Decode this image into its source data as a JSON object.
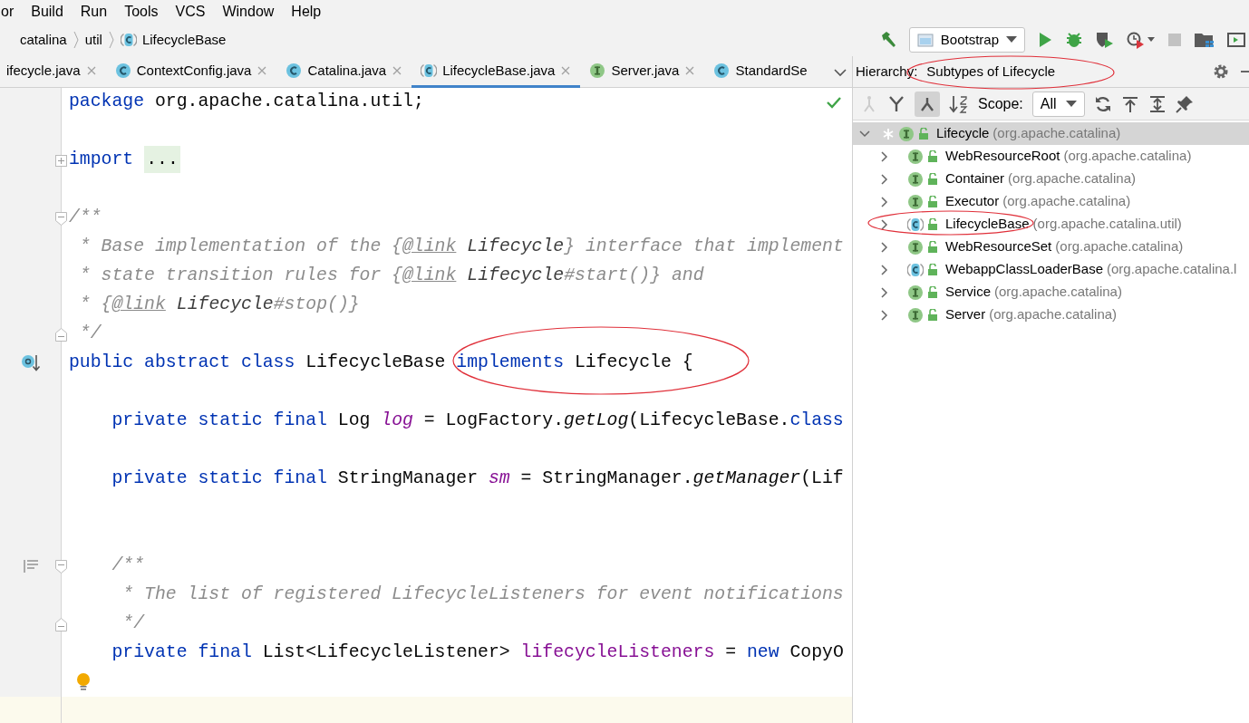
{
  "menu": [
    {
      "label": "or"
    },
    {
      "label": "Build"
    },
    {
      "label": "Run"
    },
    {
      "label": "Tools"
    },
    {
      "label": "VCS"
    },
    {
      "label": "Window"
    },
    {
      "label": "Help"
    }
  ],
  "breadcrumb": [
    {
      "label": "catalina"
    },
    {
      "label": "util"
    },
    {
      "label": "LifecycleBase",
      "kind": "abstract-class"
    }
  ],
  "run_config": {
    "label": "Bootstrap"
  },
  "tabs": [
    {
      "label": "ifecycle.java",
      "selected": false,
      "closable": true
    },
    {
      "label": "ContextConfig.java",
      "kind": "class",
      "selected": false,
      "closable": true
    },
    {
      "label": "Catalina.java",
      "kind": "class",
      "selected": false,
      "closable": true
    },
    {
      "label": "LifecycleBase.java",
      "kind": "abstract-class",
      "selected": true,
      "closable": true
    },
    {
      "label": "Server.java",
      "kind": "interface",
      "selected": false,
      "closable": true
    },
    {
      "label": "StandardSe",
      "kind": "class",
      "selected": false,
      "closable": false
    }
  ],
  "editor": {
    "lines": [
      {
        "current": false,
        "tokens": [
          {
            "kind": "keyword",
            "text": "package"
          },
          {
            "kind": "plain",
            "text": " org.apache.catalina.util;"
          }
        ]
      },
      {
        "current": false
      },
      {
        "current": false,
        "tokens": [
          {
            "kind": "keyword",
            "text": "import"
          },
          {
            "kind": "folded",
            "text": "..."
          }
        ]
      },
      {
        "current": false
      },
      {
        "current": false,
        "tokens": [
          {
            "kind": "comment",
            "text": "/**"
          }
        ]
      },
      {
        "current": false,
        "tokens": [
          {
            "kind": "comment",
            "text": " * Base implementation of the {"
          },
          {
            "kind": "doctag",
            "text": "@link"
          },
          {
            "kind": "docref",
            "text": "Lifecycle"
          },
          {
            "kind": "comment",
            "text": "} interface that implement"
          }
        ]
      },
      {
        "current": false,
        "tokens": [
          {
            "kind": "comment",
            "text": " * state transition rules for {"
          },
          {
            "kind": "doctag",
            "text": "@link"
          },
          {
            "kind": "docref",
            "text": "Lifecycle"
          },
          {
            "kind": "comment",
            "text": "#start()} and"
          }
        ]
      },
      {
        "current": false,
        "tokens": [
          {
            "kind": "comment",
            "text": " * {"
          },
          {
            "kind": "doctag",
            "text": "@link"
          },
          {
            "kind": "docref",
            "text": "Lifecycle"
          },
          {
            "kind": "comment",
            "text": "#stop()}"
          }
        ]
      },
      {
        "current": false,
        "tokens": [
          {
            "kind": "comment",
            "text": " */"
          }
        ]
      },
      {
        "current": false,
        "tokens": [
          {
            "kind": "keyword",
            "text": "public abstract class"
          },
          {
            "kind": "plain",
            "text": " LifecycleBase "
          },
          {
            "kind": "keyword",
            "text": "implements"
          },
          {
            "kind": "plain",
            "text": " Lifecycle {"
          }
        ]
      },
      {
        "current": false
      },
      {
        "current": false,
        "tokens": [
          {
            "kind": "keyword",
            "text": "    private static final"
          },
          {
            "kind": "plain",
            "text": " Log "
          },
          {
            "kind": "static-field",
            "text": "log"
          },
          {
            "kind": "plain",
            "text": " = LogFactory."
          },
          {
            "kind": "static-method",
            "text": "getLog"
          },
          {
            "kind": "plain",
            "text": "(LifecycleBase."
          },
          {
            "kind": "keyword",
            "text": "class"
          }
        ]
      },
      {
        "current": false
      },
      {
        "current": false,
        "tokens": [
          {
            "kind": "keyword",
            "text": "    private static final"
          },
          {
            "kind": "plain",
            "text": " StringManager "
          },
          {
            "kind": "static-field",
            "text": "sm"
          },
          {
            "kind": "plain",
            "text": " = StringManager."
          },
          {
            "kind": "static-method",
            "text": "getManager"
          },
          {
            "kind": "plain",
            "text": "(Lif"
          }
        ]
      },
      {
        "current": false
      },
      {
        "current": false
      },
      {
        "current": false,
        "tokens": [
          {
            "kind": "comment",
            "text": "    /**"
          }
        ]
      },
      {
        "current": false,
        "tokens": [
          {
            "kind": "comment",
            "text": "     * The list of registered LifecycleListeners for event notifications"
          }
        ]
      },
      {
        "current": false,
        "tokens": [
          {
            "kind": "comment",
            "text": "     */"
          }
        ]
      },
      {
        "current": false,
        "tokens": [
          {
            "kind": "keyword",
            "text": "    private final"
          },
          {
            "kind": "plain",
            "text": " List<LifecycleListener> "
          },
          {
            "kind": "field",
            "text": "lifecycleListeners"
          },
          {
            "kind": "plain",
            "text": " = "
          },
          {
            "kind": "keyword",
            "text": "new"
          },
          {
            "kind": "plain",
            "text": " CopyO"
          }
        ]
      },
      {
        "current": false
      },
      {
        "current": true
      }
    ]
  },
  "hierarchy": {
    "label": "Hierarchy:",
    "title": "Subtypes of Lifecycle",
    "scope_label": "Scope:",
    "scope": "All",
    "tree": [
      {
        "name": "Lifecycle",
        "package": "(org.apache.catalina)",
        "kind": "interface",
        "expanded": true,
        "selected": true,
        "children": [
          {
            "name": "WebResourceRoot",
            "package": "(org.apache.catalina)",
            "kind": "interface",
            "expanded": false,
            "selected": false
          },
          {
            "name": "Container",
            "package": "(org.apache.catalina)",
            "kind": "interface",
            "expanded": false,
            "selected": false
          },
          {
            "name": "Executor",
            "package": "(org.apache.catalina)",
            "kind": "interface",
            "expanded": false,
            "selected": false
          },
          {
            "name": "LifecycleBase",
            "package": "(org.apache.catalina.util)",
            "kind": "abstract-class",
            "expanded": false,
            "selected": false
          },
          {
            "name": "WebResourceSet",
            "package": "(org.apache.catalina)",
            "kind": "interface",
            "expanded": false,
            "selected": false
          },
          {
            "name": "WebappClassLoaderBase",
            "package": "(org.apache.catalina.l",
            "kind": "abstract-class",
            "expanded": false,
            "selected": false
          },
          {
            "name": "Service",
            "package": "(org.apache.catalina)",
            "kind": "interface",
            "expanded": false,
            "selected": false
          },
          {
            "name": "Server",
            "package": "(org.apache.catalina)",
            "kind": "interface",
            "expanded": false,
            "selected": false
          }
        ]
      }
    ]
  }
}
